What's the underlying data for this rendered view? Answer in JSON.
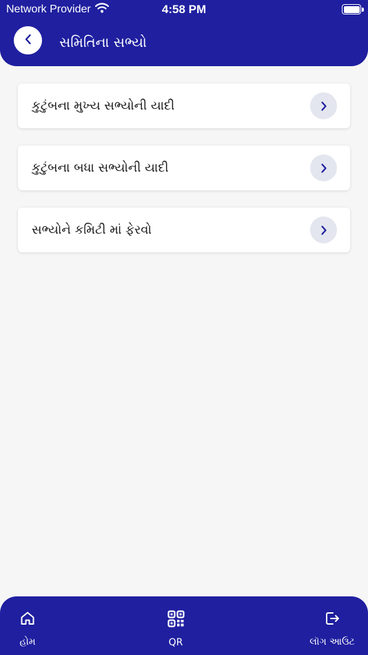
{
  "status_bar": {
    "carrier": "Network Provider",
    "time": "4:58 PM"
  },
  "header": {
    "title": "સમિતિના સભ્યો",
    "back_icon": "chevron-left-icon"
  },
  "menu": {
    "items": [
      {
        "label": "કુટુંબના મુખ્ય સભ્યોની યાદી",
        "icon": "chevron-right-icon"
      },
      {
        "label": "કુટુંબના બધા સભ્યોની યાદી",
        "icon": "chevron-right-icon"
      },
      {
        "label": "સભ્યોને કમિટી માં ફેરવો",
        "icon": "chevron-right-icon"
      }
    ]
  },
  "bottom_nav": {
    "home_label": "હોમ",
    "qr_label": "QR",
    "logout_label": "લૉગ આઉટ"
  },
  "colors": {
    "primary": "#1f1fa0",
    "background": "#f6f6f6",
    "card": "#ffffff",
    "chevron_bg": "#e3e6ee",
    "chevron": "#1f1fa0"
  }
}
